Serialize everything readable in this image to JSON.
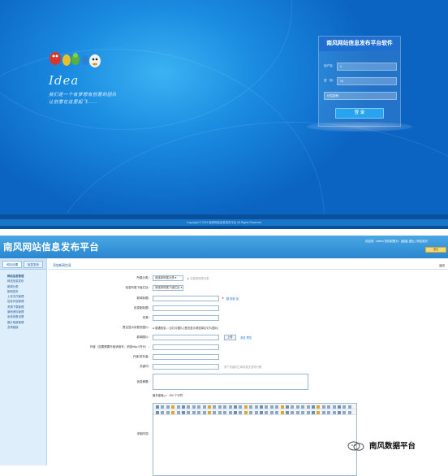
{
  "login_screen": {
    "logo_word": "Idea",
    "slogan_line1": "我们是一个有梦想有创意的团队",
    "slogan_line2": "让创意在这里起飞......",
    "panel_title": "南风网站信息发布平台软件",
    "username_label": "用户名：",
    "username_value": "1",
    "password_label": "密　码：",
    "password_value": "12",
    "remember_label": "记住密码",
    "login_button": "登 录",
    "copyright": "Copyright © 2021 南风网站信息发布平台 All Rights Reserved"
  },
  "admin": {
    "app_title": "南风网站信息发布平台",
    "welcome_text": "欢迎您：admin  您的权限为：[超级] 退出 | 网站首页",
    "logout_label": "退出",
    "sidebar": {
      "tabs": [
        "网站设置",
        "信息发布"
      ],
      "items": [
        "网站信息管理",
        "网站信息发布",
        "新闻分类",
        "新闻发布",
        "上传文件管理",
        "信息内容管理",
        "资源下载管理",
        "案例资料管理",
        "系统参数设置",
        "图片相册管理",
        "友情链接"
      ]
    },
    "breadcrumb": "添加新闻信息",
    "back_label": "返回",
    "form": {
      "category_label": "所属分类：",
      "category_value": "请选择所属分类",
      "category_hint": "★ 请选择所属分类",
      "subcategory_label": "信息所属下级栏目：",
      "subcategory_value": "请选择所属下级栏目",
      "title_label": "新闻标题：",
      "title_links": "粗 颜色 加",
      "subtitle_label": "信息副标题：",
      "source_label": "来源：",
      "image_upload_label": "是否显示到首页图片：",
      "image_upload_options": "● 普通信息  ○ 幻灯片图片  [首页显示请选择幻灯片图片]",
      "news_image_label": "新闻图片：",
      "upload_button": "上传",
      "upload_links": "浏览 预览",
      "external_link_label": "外链（如果需要外链请填写，例如http://开头）：",
      "author_label": "作者/发布者：",
      "keywords_label": "关键词：",
      "keywords_hint": "多个关键词之间用英文逗号分隔",
      "summary_label": "信息摘要：",
      "word_count": "最多能输入：200 个字符",
      "content_label": "详细内容："
    }
  },
  "watermark": {
    "text": "南风数据平台"
  }
}
